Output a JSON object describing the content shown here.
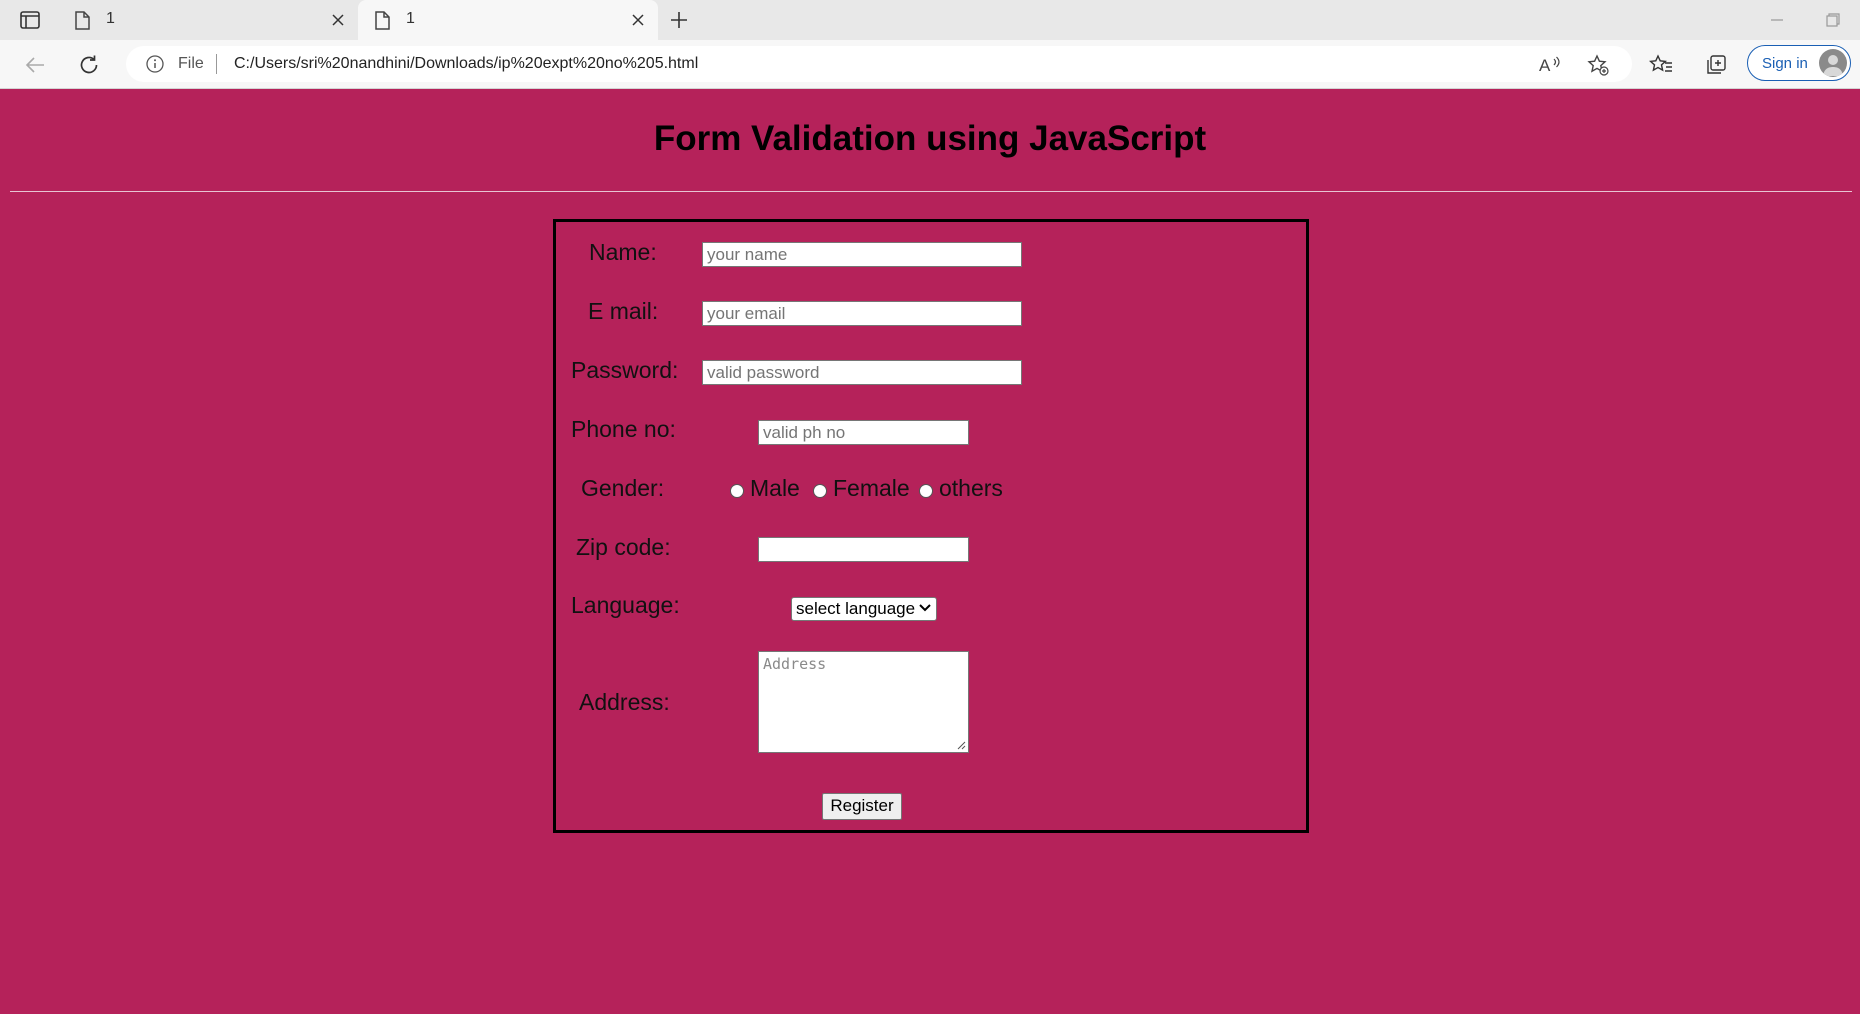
{
  "browser": {
    "tabs": [
      {
        "title": "1"
      },
      {
        "title": "1"
      }
    ],
    "address": {
      "scheme_label": "File",
      "url": "C:/Users/sri%20nandhini/Downloads/ip%20expt%20no%205.html"
    },
    "sign_in_label": "Sign in"
  },
  "page": {
    "heading": "Form Validation using JavaScript",
    "form": {
      "name": {
        "label": "Name:",
        "placeholder": "your name"
      },
      "email": {
        "label": "E mail:",
        "placeholder": "your email"
      },
      "password": {
        "label": "Password:",
        "placeholder": "valid password"
      },
      "phone": {
        "label": "Phone no:",
        "placeholder": "valid ph no"
      },
      "gender": {
        "label": "Gender:",
        "options": [
          "Male",
          "Female",
          "others"
        ]
      },
      "zip": {
        "label": "Zip code:",
        "placeholder": ""
      },
      "language": {
        "label": "Language:",
        "selected": "select language"
      },
      "address": {
        "label": "Address:",
        "placeholder": "Address"
      },
      "submit_label": "Register"
    }
  },
  "colors": {
    "page_background": "#b5225a",
    "form_border": "#000000",
    "sign_in_accent": "#1a5fb4"
  }
}
